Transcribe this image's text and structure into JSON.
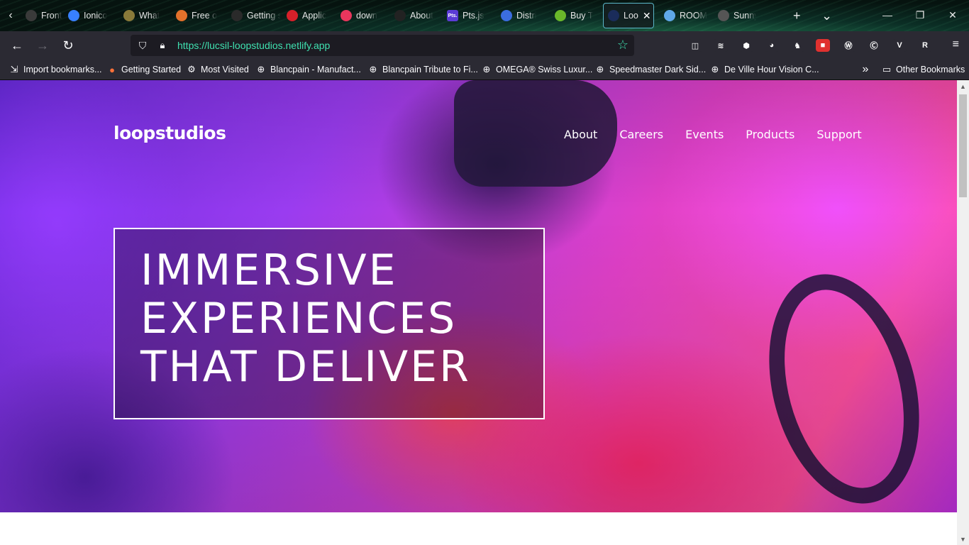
{
  "tabs": [
    {
      "title": "Fronte",
      "icon_color": "#3a3a3a",
      "icon_name": "frontend-mentor-icon"
    },
    {
      "title": "Ionico",
      "icon_color": "#3880ff",
      "icon_name": "ionicons-icon"
    },
    {
      "title": "What",
      "icon_color": "#8a7a3a",
      "icon_name": "what-icon"
    },
    {
      "title": "Free o",
      "icon_color": "#e2712b",
      "icon_name": "free-icon"
    },
    {
      "title": "Getting sta",
      "icon_color": "#2a2a2a",
      "icon_name": "getting-started-icon"
    },
    {
      "title": "Applic",
      "icon_color": "#d6202a",
      "icon_name": "application-icon"
    },
    {
      "title": "down",
      "icon_color": "#e8365d",
      "icon_name": "asterisk-icon"
    },
    {
      "title": "About",
      "icon_color": "#222222",
      "icon_name": "about-icon"
    },
    {
      "title": "Pts.js",
      "icon_color": "#5b3bd6",
      "icon_name": "pts-icon",
      "icon_text": "Pts."
    },
    {
      "title": "Distri",
      "icon_color": "#3b6de0",
      "icon_name": "droplet-icon"
    },
    {
      "title": "Buy T",
      "icon_color": "#6ab82a",
      "icon_name": "buy-icon"
    },
    {
      "title": "Loo",
      "icon_color": "#1a2c5a",
      "icon_name": "loopstudios-icon",
      "active": true
    },
    {
      "title": "ROOM",
      "icon_color": "#5fa8e8",
      "icon_name": "diamond-icon"
    },
    {
      "title": "Sunny",
      "icon_color": "#555555",
      "icon_name": "sunny-icon"
    }
  ],
  "tab_close": "✕",
  "tab_new": "+",
  "tab_list": "⌄",
  "window": {
    "minimize": "—",
    "restore": "❐",
    "close": "✕"
  },
  "nav": {
    "back": "←",
    "forward": "→",
    "reload": "↻"
  },
  "urlbar": {
    "url": "https://lucsil-loopstudios.netlify.app",
    "shield": "⛉",
    "lock": "🔒︎",
    "star": "☆"
  },
  "extensions": [
    {
      "name": "pocket-icon",
      "color": "#2b2a33",
      "glyph": "◫"
    },
    {
      "name": "layers-icon",
      "color": "#2b2a33",
      "glyph": "≋"
    },
    {
      "name": "shield-blue-icon",
      "color": "#2b2a33",
      "glyph": "⬢"
    },
    {
      "name": "color-picker-icon",
      "color": "#2b2a33",
      "glyph": "◕"
    },
    {
      "name": "fox-icon",
      "color": "#2b2a33",
      "glyph": "♞"
    },
    {
      "name": "red-lock-icon",
      "color": "#e0312f",
      "glyph": "■"
    },
    {
      "name": "w-icon",
      "color": "#2b2a33",
      "glyph": "Ⓦ"
    },
    {
      "name": "c-icon",
      "color": "#2b2a33",
      "glyph": "Ⓒ"
    },
    {
      "name": "vue-icon",
      "color": "#2b2a33",
      "glyph": "V"
    },
    {
      "name": "rn-icon",
      "color": "#2b2a33",
      "glyph": "R"
    }
  ],
  "menu": "≡",
  "bookmarks": [
    {
      "label": "Import bookmarks...",
      "icon": "⇲",
      "icon_name": "import-icon"
    },
    {
      "label": "Getting Started",
      "icon": "●",
      "icon_name": "firefox-icon"
    },
    {
      "label": "Most Visited",
      "icon": "⚙",
      "icon_name": "gear-icon"
    },
    {
      "label": "Blancpain - Manufact...",
      "icon": "⊕",
      "icon_name": "globe-icon"
    },
    {
      "label": "Blancpain Tribute to Fi...",
      "icon": "⊕",
      "icon_name": "globe-icon"
    },
    {
      "label": "OMEGA® Swiss Luxur...",
      "icon": "⊕",
      "icon_name": "globe-icon"
    },
    {
      "label": "Speedmaster Dark Sid...",
      "icon": "⊕",
      "icon_name": "globe-icon"
    },
    {
      "label": "De Ville Hour Vision C...",
      "icon": "⊕",
      "icon_name": "globe-icon"
    }
  ],
  "bookmarks_more": "»",
  "other_bookmarks": {
    "label": "Other Bookmarks",
    "icon": "▭"
  },
  "site": {
    "logo": "loopstudios",
    "nav": [
      "About",
      "Careers",
      "Events",
      "Products",
      "Support"
    ],
    "headline": [
      "IMMERSIVE",
      "EXPERIENCES",
      "THAT DELIVER"
    ]
  },
  "scrollbar": {
    "up": "▲",
    "down": "▼"
  }
}
